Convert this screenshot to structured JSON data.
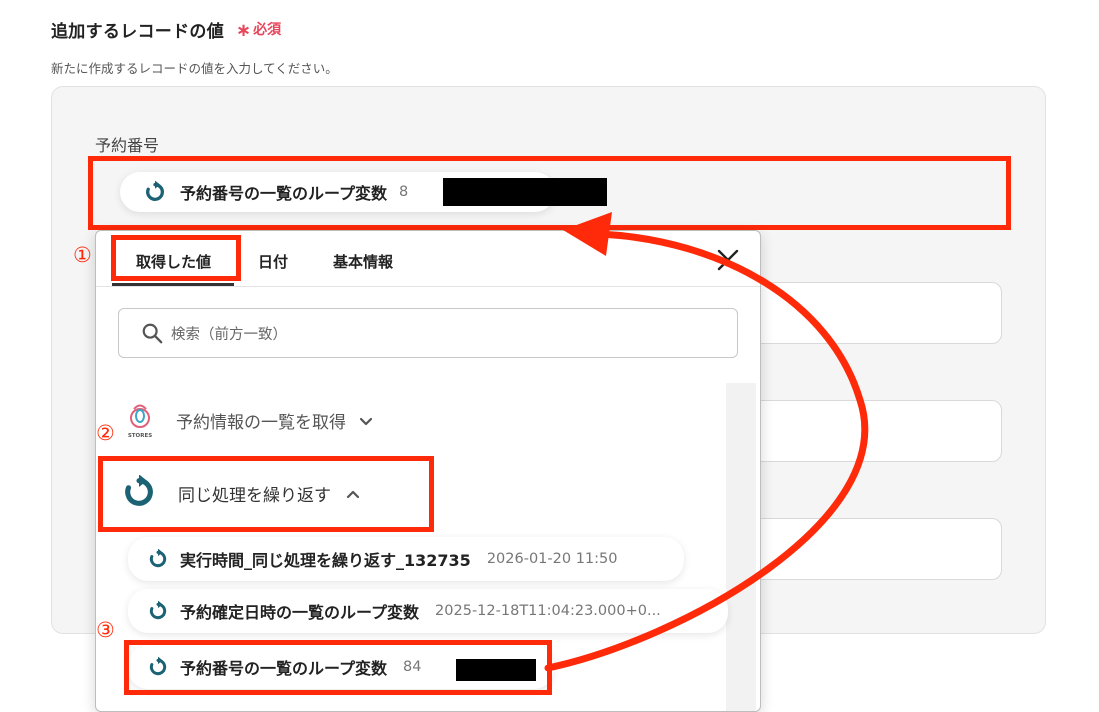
{
  "section": {
    "title": "追加するレコードの値",
    "required": "必須",
    "description": "新たに作成するレコードの値を入力してください。"
  },
  "field": {
    "label": "予約番号",
    "chip_name": "予約番号の一覧のループ変数",
    "chip_value_prefix": "8"
  },
  "dropdown": {
    "tabs": [
      "取得した値",
      "日付",
      "基本情報"
    ],
    "active_tab": 0,
    "search_placeholder": "検索（前方一致）",
    "groups": [
      {
        "label": "予約情報の一覧を取得",
        "logo_text": "STORES",
        "expanded": false
      },
      {
        "label": "同じ処理を繰り返す",
        "expanded": true
      }
    ],
    "items": [
      {
        "name": "実行時間_同じ処理を繰り返す_132735",
        "value": "2026-01-20 11:50"
      },
      {
        "name": "予約確定日時の一覧のループ変数",
        "value": "2025-12-18T11:04:23.000+0..."
      },
      {
        "name": "予約番号の一覧のループ変数",
        "value": "84"
      }
    ]
  },
  "annotations": [
    "①",
    "②",
    "③"
  ],
  "colors": {
    "highlight": "#ff2a0a",
    "required": "#e8465b",
    "loop_icon": "#1c6275"
  }
}
